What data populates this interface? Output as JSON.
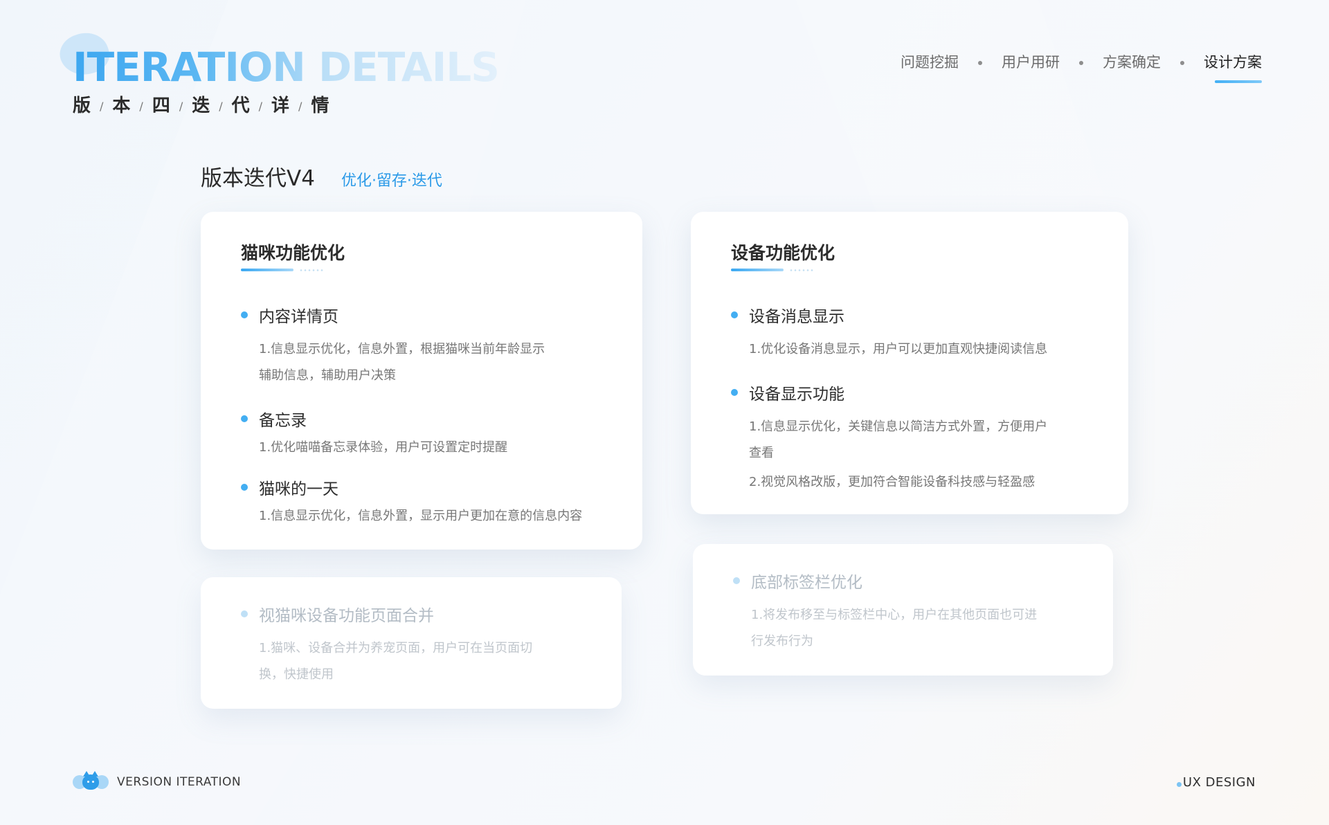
{
  "header": {
    "title_main": "ITERATION",
    "title_faded": "DETAILS",
    "subtitle_chars": [
      "版",
      "本",
      "四",
      "迭",
      "代",
      "详",
      "情"
    ],
    "subtitle_separator": "/"
  },
  "nav": {
    "items": [
      {
        "label": "问题挖掘",
        "active": false
      },
      {
        "label": "用户用研",
        "active": false
      },
      {
        "label": "方案确定",
        "active": false
      },
      {
        "label": "设计方案",
        "active": true
      }
    ]
  },
  "section": {
    "title": "版本迭代V4",
    "tags": "优化·留存·迭代"
  },
  "cards": {
    "cat": {
      "title": "猫咪功能优化",
      "entries": [
        {
          "name": "内容详情页",
          "desc_lines": [
            "1.信息显示优化，信息外置，根据猫咪当前年龄显示",
            "辅助信息，辅助用户决策"
          ]
        },
        {
          "name": "备忘录",
          "desc_lines": [
            "1.优化喵喵备忘录体验，用户可设置定时提醒"
          ]
        },
        {
          "name": "猫咪的一天",
          "desc_lines": [
            "1.信息显示优化，信息外置，显示用户更加在意的信息内容"
          ]
        }
      ]
    },
    "device": {
      "title": "设备功能优化",
      "entries": [
        {
          "name": "设备消息显示",
          "desc_lines": [
            "1.优化设备消息显示，用户可以更加直观快捷阅读信息"
          ]
        },
        {
          "name": "设备显示功能",
          "desc_lines": [
            "1.信息显示优化，关键信息以简洁方式外置，方便用户",
            "查看",
            "2.视觉风格改版，更加符合智能设备科技感与轻盈感"
          ]
        }
      ]
    },
    "merge": {
      "name": "视猫咪设备功能页面合并",
      "desc_lines": [
        "1.猫咪、设备合并为养宠页面，用户可在当页面切",
        "换，快捷使用"
      ]
    },
    "tabbar": {
      "name": "底部标签栏优化",
      "desc_lines": [
        "1.将发布移至与标签栏中心，用户在其他页面也可进",
        "行发布行为"
      ]
    }
  },
  "footer": {
    "left_label": "VERSION ITERATION",
    "right_label": "UX DESIGN"
  },
  "colors": {
    "accent": "#2b9ae8",
    "bullet": "#43aef2"
  }
}
